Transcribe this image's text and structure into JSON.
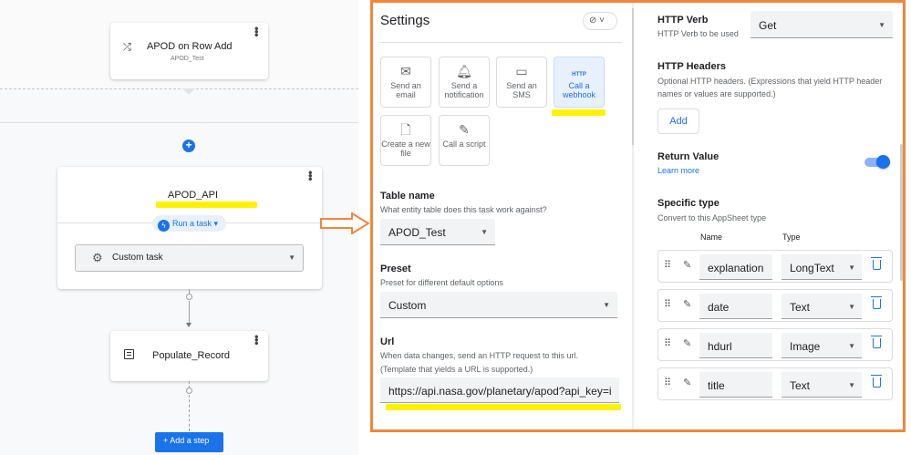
{
  "canvas": {
    "event_card": {
      "title": "APOD on Row Add",
      "subtitle": "APOD_Test",
      "icon": "shuffle-icon"
    },
    "task_card": {
      "title": "APOD_API",
      "chip_label": "Run a task",
      "chip_icon": "bolt-icon",
      "task_select": "Custom task",
      "select_icon": "gear-icon"
    },
    "step_card": {
      "title": "Populate_Record",
      "icon": "list-icon"
    },
    "add_step_label": "+ Add a step"
  },
  "settings": {
    "title": "Settings",
    "tiles": [
      {
        "label": "Send an email",
        "icon": "mail-icon"
      },
      {
        "label": "Send a notification",
        "icon": "bell-icon"
      },
      {
        "label": "Send an SMS",
        "icon": "chat-icon"
      },
      {
        "label": "Call a webhook",
        "icon_text": "HTTP",
        "selected": true
      },
      {
        "label": "Create a new file",
        "icon": "file-plus-icon"
      },
      {
        "label": "Call a script",
        "icon": "script-icon"
      }
    ],
    "table_name": {
      "label": "Table name",
      "desc": "What entity table does this task work against?",
      "value": "APOD_Test"
    },
    "preset": {
      "label": "Preset",
      "desc": "Preset for different default options",
      "value": "Custom"
    },
    "url": {
      "label": "Url",
      "desc1": "When data changes, send an HTTP request to this url.",
      "desc2": "(Template that yields a URL is supported.)",
      "value": "https://api.nasa.gov/planetary/apod?api_key=i"
    }
  },
  "http": {
    "verb": {
      "label": "HTTP Verb",
      "desc": "HTTP Verb to be used",
      "value": "Get"
    },
    "headers": {
      "label": "HTTP Headers",
      "desc1": "Optional HTTP headers. (Expressions that yield HTTP header",
      "desc2": "names or values are supported.)",
      "add_label": "Add"
    },
    "return_value": {
      "label": "Return Value",
      "learn_more": "Learn more",
      "enabled": true
    },
    "specific_type": {
      "label": "Specific type",
      "desc": "Convert to this AppSheet type",
      "col_name": "Name",
      "col_type": "Type",
      "rows": [
        {
          "name": "explanation",
          "type": "LongText"
        },
        {
          "name": "date",
          "type": "Text"
        },
        {
          "name": "hdurl",
          "type": "Image"
        },
        {
          "name": "title",
          "type": "Text"
        }
      ]
    }
  },
  "colors": {
    "accent": "#1a73e8",
    "highlight": "#fff200",
    "frame": "#f0873a"
  }
}
